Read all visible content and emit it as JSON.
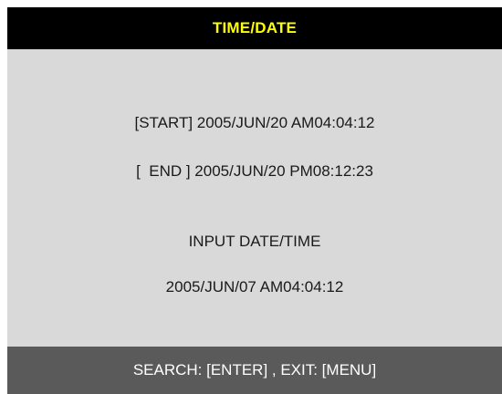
{
  "header": {
    "title": "TIME/DATE"
  },
  "search": {
    "start_line": "[START] 2005/JUN/20 AM04:04:12",
    "end_line": "[  END ] 2005/JUN/20 PM08:12:23",
    "input_label": "INPUT DATE/TIME",
    "input_value": "2005/JUN/07 AM04:04:12"
  },
  "footer": {
    "hint": "SEARCH: [ENTER] , EXIT: [MENU]"
  },
  "colors": {
    "title_bar": "#000000",
    "title_text": "#ffff00",
    "panel": "#d9d9d9",
    "footer_bar": "#5a5a5a",
    "footer_text": "#ffffff"
  }
}
